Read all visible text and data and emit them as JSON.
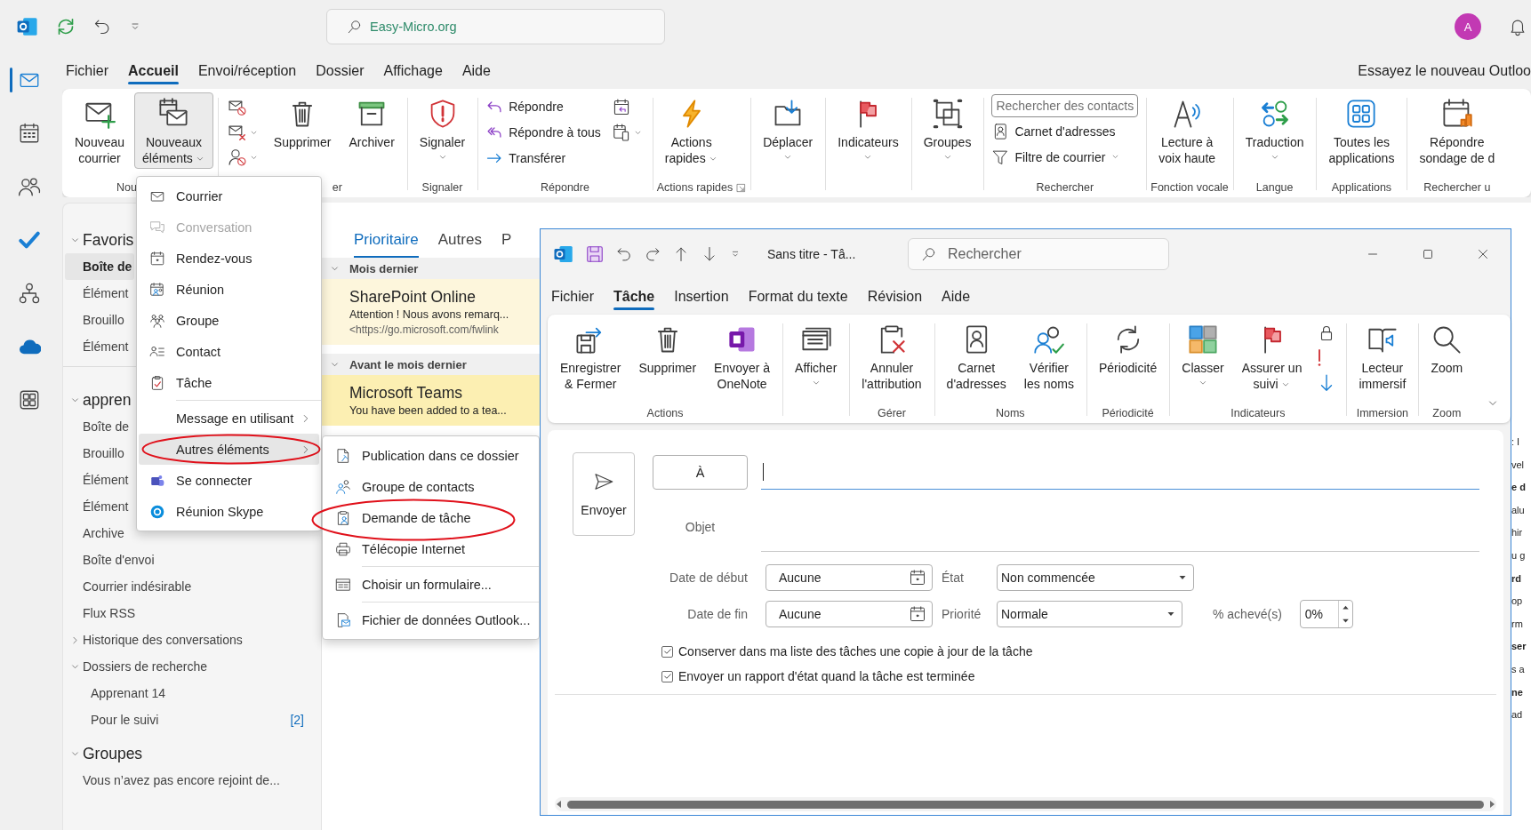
{
  "title_bar": {
    "search": {
      "placeholder": "Easy-Micro.org"
    },
    "avatar": "A"
  },
  "nav_rail": [
    {
      "selected": true
    },
    {
      "selected": false
    },
    {
      "selected": false
    },
    {
      "selected": false
    },
    {
      "selected": false
    },
    {
      "selected": false
    },
    {
      "selected": false
    }
  ],
  "menu_tabs": [
    {
      "label": "Fichier",
      "selected": false
    },
    {
      "label": "Accueil",
      "selected": true
    },
    {
      "label": "Envoi/réception",
      "selected": false
    },
    {
      "label": "Dossier",
      "selected": false
    },
    {
      "label": "Affichage",
      "selected": false
    },
    {
      "label": "Aide",
      "selected": false
    }
  ],
  "try_new": "Essayez le nouveau Outloo",
  "ribbon": {
    "groups": [
      {
        "label": "Nou",
        "cut_end": true,
        "items": [
          {
            "kind": "large",
            "label": "Nouveau\ncourrier",
            "dropdown": false,
            "pressed": false
          },
          {
            "kind": "large",
            "label": "Nouveaux\néléments",
            "dropdown": true,
            "inline_caret": true,
            "pressed": true
          }
        ]
      },
      {
        "label": "er",
        "cut_start": true,
        "items": [
          {
            "kind": "icons",
            "icons": [
              {
                "dropdown": false
              },
              {
                "dropdown": true
              },
              {
                "dropdown": true
              }
            ]
          },
          {
            "kind": "large",
            "label": "Supprimer",
            "dropdown": false,
            "pressed": false
          },
          {
            "kind": "large",
            "label": "Archiver",
            "dropdown": false,
            "pressed": false
          }
        ]
      },
      {
        "label": "Signaler",
        "items": [
          {
            "kind": "large",
            "label": "Signaler",
            "dropdown": true,
            "inline_caret": false,
            "pressed": false
          }
        ]
      },
      {
        "label": "Répondre",
        "items": [
          {
            "kind": "rows",
            "rows": [
              {
                "kind": "button",
                "label": "Répondre",
                "dropdown": false
              },
              {
                "kind": "button",
                "label": "Répondre à tous",
                "dropdown": false
              },
              {
                "kind": "button",
                "label": "Transférer",
                "dropdown": false
              }
            ]
          },
          {
            "kind": "icons",
            "icons": [
              {
                "dropdown": false
              },
              {
                "dropdown": true
              }
            ]
          }
        ]
      },
      {
        "label": "Actions rapides",
        "launcher": true,
        "items": [
          {
            "kind": "large",
            "label": "Actions\nrapides",
            "dropdown": true,
            "inline_caret": true,
            "pressed": false
          }
        ]
      },
      {
        "items": [
          {
            "kind": "large",
            "label": "Déplacer",
            "dropdown": true,
            "inline_caret": false,
            "pressed": false
          }
        ]
      },
      {
        "items": [
          {
            "kind": "large",
            "label": "Indicateurs",
            "dropdown": true,
            "inline_caret": false,
            "pressed": false
          }
        ]
      },
      {
        "items": [
          {
            "kind": "large",
            "label": "Groupes",
            "dropdown": true,
            "inline_caret": false,
            "pressed": false
          }
        ]
      },
      {
        "label": "Rechercher",
        "items": [
          {
            "kind": "rows",
            "rows": [
              {
                "kind": "search",
                "placeholder": "Rechercher des contacts"
              },
              {
                "kind": "button",
                "label": "Carnet d'adresses",
                "dropdown": false
              },
              {
                "kind": "button",
                "label": "Filtre de courrier",
                "dropdown": true
              }
            ]
          }
        ]
      },
      {
        "label": "Fonction vocale",
        "items": [
          {
            "kind": "large",
            "label": "Lecture à\nvoix haute",
            "dropdown": false,
            "pressed": false
          }
        ]
      },
      {
        "label": "Langue",
        "items": [
          {
            "kind": "large",
            "label": "Traduction",
            "dropdown": true,
            "inline_caret": false,
            "pressed": false
          }
        ]
      },
      {
        "label": "Applications",
        "items": [
          {
            "kind": "large",
            "label": "Toutes les\napplications",
            "dropdown": false,
            "pressed": false
          }
        ]
      },
      {
        "label": "Rechercher u",
        "items": [
          {
            "kind": "large",
            "label": "Répondre\nsondage de d",
            "dropdown": false,
            "pressed": false
          }
        ]
      }
    ]
  },
  "new_items_menu": [
    {
      "kind": "item",
      "label": "Courrier",
      "selected": false,
      "disabled": false,
      "submenu": false,
      "circled": false
    },
    {
      "kind": "item",
      "label": "Conversation",
      "selected": false,
      "disabled": true,
      "submenu": false,
      "circled": false
    },
    {
      "kind": "item",
      "label": "Rendez-vous",
      "selected": false,
      "disabled": false,
      "submenu": false,
      "circled": false
    },
    {
      "kind": "item",
      "label": "Réunion",
      "selected": false,
      "disabled": false,
      "submenu": false,
      "circled": false
    },
    {
      "kind": "item",
      "label": "Groupe",
      "selected": false,
      "disabled": false,
      "submenu": false,
      "circled": false
    },
    {
      "kind": "item",
      "label": "Contact",
      "selected": false,
      "disabled": false,
      "submenu": false,
      "circled": false
    },
    {
      "kind": "item",
      "label": "Tâche",
      "selected": false,
      "disabled": false,
      "submenu": false,
      "circled": false
    },
    {
      "kind": "separator"
    },
    {
      "kind": "item",
      "label": "Message en utilisant",
      "selected": false,
      "disabled": false,
      "submenu": true,
      "circled": false
    },
    {
      "kind": "item",
      "label": "Autres éléments",
      "selected": true,
      "disabled": false,
      "submenu": true,
      "circled": true
    },
    {
      "kind": "item",
      "label": "Se connecter",
      "selected": false,
      "disabled": false,
      "submenu": false,
      "circled": false
    },
    {
      "kind": "item",
      "label": "Réunion Skype",
      "selected": false,
      "disabled": false,
      "submenu": false,
      "circled": false
    }
  ],
  "other_items_menu": [
    {
      "kind": "item",
      "label": "Publication dans ce dossier",
      "selected": false,
      "disabled": false,
      "submenu": false,
      "circled": false
    },
    {
      "kind": "item",
      "label": "Groupe de contacts",
      "selected": false,
      "disabled": false,
      "submenu": false,
      "circled": false
    },
    {
      "kind": "item",
      "label": "Demande de tâche",
      "selected": false,
      "disabled": false,
      "submenu": false,
      "circled": true
    },
    {
      "kind": "item",
      "label": "Télécopie Internet",
      "selected": false,
      "disabled": false,
      "submenu": false,
      "circled": false
    },
    {
      "kind": "separator"
    },
    {
      "kind": "item",
      "label": "Choisir un formulaire...",
      "selected": false,
      "disabled": false,
      "submenu": false,
      "circled": false
    },
    {
      "kind": "separator"
    },
    {
      "kind": "item",
      "label": "Fichier de données Outlook...",
      "selected": false,
      "disabled": false,
      "submenu": false,
      "circled": false
    }
  ],
  "folders": [
    {
      "label": "Favoris",
      "expanded": true,
      "children": [
        {
          "label": "Boîte de",
          "selected": true
        },
        {
          "label": "Élément",
          "selected": false
        },
        {
          "label": "Brouillo",
          "selected": false
        },
        {
          "label": "Élément",
          "selected": false
        }
      ]
    },
    {
      "label": "appren",
      "expanded": true,
      "children": [
        {
          "label": "Boîte de",
          "selected": false
        },
        {
          "label": "Brouillo",
          "selected": false
        },
        {
          "label": "Élément",
          "selected": false
        },
        {
          "label": "Élément",
          "selected": false
        },
        {
          "label": "Archive",
          "selected": false
        },
        {
          "label": "Boîte d'envoi",
          "selected": false
        },
        {
          "label": "Courrier indésirable",
          "selected": false
        },
        {
          "label": "Flux RSS",
          "selected": false
        },
        {
          "label": "Historique des conversations",
          "selected": false,
          "expanded": false
        },
        {
          "label": "Dossiers de recherche",
          "selected": false,
          "expanded": true,
          "children": [
            {
              "label": "Apprenant 14",
              "selected": false
            },
            {
              "label": "Pour le suivi",
              "selected": false,
              "count": "[2]"
            }
          ]
        }
      ]
    },
    {
      "label": "Groupes",
      "expanded": true,
      "children": [
        {
          "label": "Vous n’avez pas encore rejoint de...",
          "selected": false
        }
      ]
    }
  ],
  "messages": {
    "tabs": [
      {
        "label": "Prioritaire",
        "selected": true
      },
      {
        "label": "Autres",
        "selected": false
      },
      {
        "label": "P",
        "selected": false
      }
    ],
    "groups": [
      {
        "header": "Mois dernier",
        "expanded": true,
        "items": [
          {
            "sender": "SharePoint Online",
            "preview": "Attention ! Nous avons remarq...",
            "link": "<https://go.microsoft.com/fwlink",
            "selected": false
          }
        ]
      },
      {
        "header": "Avant le mois dernier",
        "expanded": true,
        "items": [
          {
            "sender": "Microsoft Teams",
            "preview": "You have been added to a tea...",
            "selected": true
          }
        ]
      }
    ]
  },
  "reading_pane_fragments": [
    {
      "text": ": I",
      "kind": "text"
    },
    {
      "text": "vel",
      "kind": "text"
    },
    {
      "text": "e d",
      "kind": "heading"
    },
    {
      "text": "alu",
      "kind": "text"
    },
    {
      "text": "hir",
      "kind": "text"
    },
    {
      "text": "u g",
      "kind": "text"
    },
    {
      "text": "rd",
      "kind": "heading"
    },
    {
      "text": "op",
      "kind": "text"
    },
    {
      "text": "rm",
      "kind": "text"
    },
    {
      "text": "ser",
      "kind": "heading"
    },
    {
      "text": "s a",
      "kind": "text"
    },
    {
      "text": "ne",
      "kind": "heading"
    },
    {
      "text": "ad",
      "kind": "text"
    }
  ],
  "task_window": {
    "title": "Sans titre - Tâ...",
    "search": {
      "placeholder": "Rechercher"
    },
    "tabs": [
      {
        "label": "Fichier",
        "selected": false
      },
      {
        "label": "Tâche",
        "selected": true
      },
      {
        "label": "Insertion",
        "selected": false
      },
      {
        "label": "Format du texte",
        "selected": false
      },
      {
        "label": "Révision",
        "selected": false
      },
      {
        "label": "Aide",
        "selected": false
      }
    ],
    "ribbon": {
      "groups": [
        {
          "label": "Actions",
          "items": [
            {
              "kind": "large",
              "label": "Enregistrer\n& Fermer",
              "dropdown": false
            },
            {
              "kind": "large",
              "label": "Supprimer",
              "dropdown": false
            },
            {
              "kind": "large",
              "label": "Envoyer à\nOneNote",
              "dropdown": false
            }
          ]
        },
        {
          "items": [
            {
              "kind": "large",
              "label": "Afficher",
              "dropdown": true,
              "inline_caret": false
            }
          ]
        },
        {
          "label": "Gérer",
          "items": [
            {
              "kind": "large",
              "label": "Annuler\nl'attribution",
              "dropdown": false
            }
          ]
        },
        {
          "label": "Noms",
          "items": [
            {
              "kind": "large",
              "label": "Carnet\nd'adresses",
              "dropdown": false
            },
            {
              "kind": "large",
              "label": "Vérifier\nles noms",
              "dropdown": false
            }
          ]
        },
        {
          "label": "Périodicité",
          "items": [
            {
              "kind": "large",
              "label": "Périodicité",
              "dropdown": false
            }
          ]
        },
        {
          "label": "Indicateurs",
          "items": [
            {
              "kind": "large",
              "label": "Classer",
              "dropdown": true,
              "inline_caret": false
            },
            {
              "kind": "large",
              "label": "Assurer un\nsuivi",
              "dropdown": true,
              "inline_caret": true
            },
            {
              "kind": "icons",
              "icons": [
                {
                  "dropdown": false
                },
                {
                  "dropdown": false
                },
                {
                  "dropdown": false
                }
              ]
            }
          ]
        },
        {
          "label": "Immersion",
          "items": [
            {
              "kind": "large",
              "label": "Lecteur\nimmersif",
              "dropdown": false
            }
          ]
        },
        {
          "label": "Zoom",
          "items": [
            {
              "kind": "large",
              "label": "Zoom",
              "dropdown": false
            }
          ]
        }
      ]
    },
    "form": {
      "send": "Envoyer",
      "to_button": "À",
      "subject_label": "Objet",
      "start_label": "Date de début",
      "start_value": "Aucune",
      "status_label": "État",
      "status_value": "Non commencée",
      "due_label": "Date de fin",
      "due_value": "Aucune",
      "priority_label": "Priorité",
      "priority_value": "Normale",
      "percent_label": "% achevé(s)",
      "percent_value": "0%",
      "checkboxes": [
        {
          "label": "Conserver dans ma liste des tâches une copie à jour de la tâche",
          "checked": true
        },
        {
          "label": "Envoyer un rapport d'état quand la tâche est terminée",
          "checked": true
        }
      ]
    }
  }
}
